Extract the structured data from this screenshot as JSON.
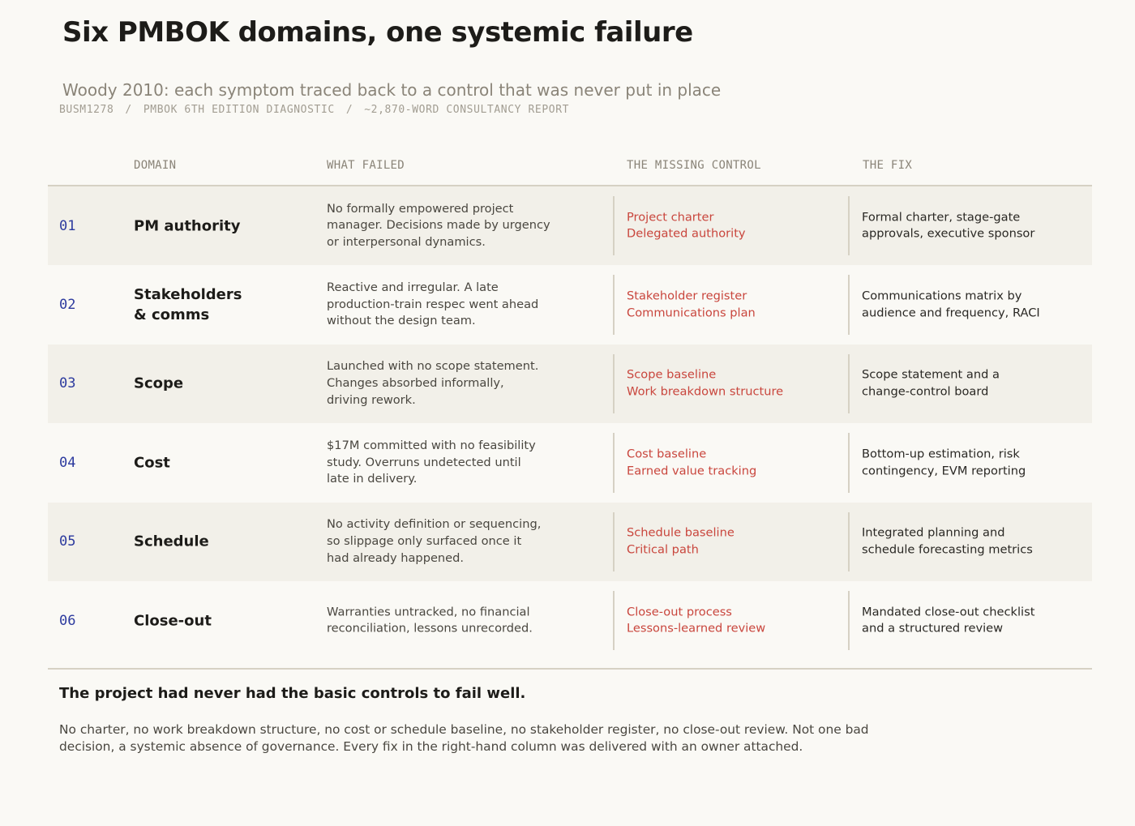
{
  "header": {
    "title": "Six PMBOK domains, one systemic failure",
    "subtitle": "Woody 2010: each symptom traced back to a control that was never put in place",
    "meta": [
      "BUSM1278",
      "PMBOK 6TH EDITION DIAGNOSTIC",
      "~2,870-WORD CONSULTANCY REPORT"
    ],
    "meta_separator": "/"
  },
  "table": {
    "columns": [
      "DOMAIN",
      "WHAT FAILED",
      "THE MISSING CONTROL",
      "THE FIX"
    ],
    "rows": [
      {
        "num": "01",
        "domain": [
          "PM authority"
        ],
        "failed": [
          "No formally empowered project",
          "manager. Decisions made by urgency",
          "or interpersonal dynamics."
        ],
        "control": [
          "Project charter",
          "Delegated authority"
        ],
        "fix": [
          "Formal charter, stage-gate",
          "approvals, executive sponsor"
        ]
      },
      {
        "num": "02",
        "domain": [
          "Stakeholders",
          "& comms"
        ],
        "failed": [
          "Reactive and irregular. A late",
          "production-train respec went ahead",
          "without the design team."
        ],
        "control": [
          "Stakeholder register",
          "Communications plan"
        ],
        "fix": [
          "Communications matrix by",
          "audience and frequency, RACI"
        ]
      },
      {
        "num": "03",
        "domain": [
          "Scope"
        ],
        "failed": [
          "Launched with no scope statement.",
          "Changes absorbed informally,",
          "driving rework."
        ],
        "control": [
          "Scope baseline",
          "Work breakdown structure"
        ],
        "fix": [
          "Scope statement and a",
          "change-control board"
        ]
      },
      {
        "num": "04",
        "domain": [
          "Cost"
        ],
        "failed": [
          "$17M committed with no feasibility",
          "study. Overruns undetected until",
          "late in delivery."
        ],
        "control": [
          "Cost baseline",
          "Earned value tracking"
        ],
        "fix": [
          "Bottom-up estimation, risk",
          "contingency, EVM reporting"
        ]
      },
      {
        "num": "05",
        "domain": [
          "Schedule"
        ],
        "failed": [
          "No activity definition or sequencing,",
          "so slippage only surfaced once it",
          "had already happened."
        ],
        "control": [
          "Schedule baseline",
          "Critical path"
        ],
        "fix": [
          "Integrated planning and",
          "schedule forecasting metrics"
        ]
      },
      {
        "num": "06",
        "domain": [
          "Close-out"
        ],
        "failed": [
          "Warranties untracked, no financial",
          "reconciliation, lessons unrecorded."
        ],
        "control": [
          "Close-out process",
          "Lessons-learned review"
        ],
        "fix": [
          "Mandated close-out checklist",
          "and a structured review"
        ]
      }
    ]
  },
  "conclusion": {
    "heading": "The project had never had the basic controls to fail well.",
    "body": "No charter, no work breakdown structure, no cost or schedule baseline, no stakeholder register, no close-out review. Not one bad decision, a systemic absence of governance. Every fix in the right-hand column was delivered with an owner attached."
  },
  "colors": {
    "background": "#faf9f5",
    "row_shade": "#f2f0e9",
    "row_number": "#2c3a9e",
    "missing_control": "#c9463d",
    "muted_text": "#8a8478"
  }
}
